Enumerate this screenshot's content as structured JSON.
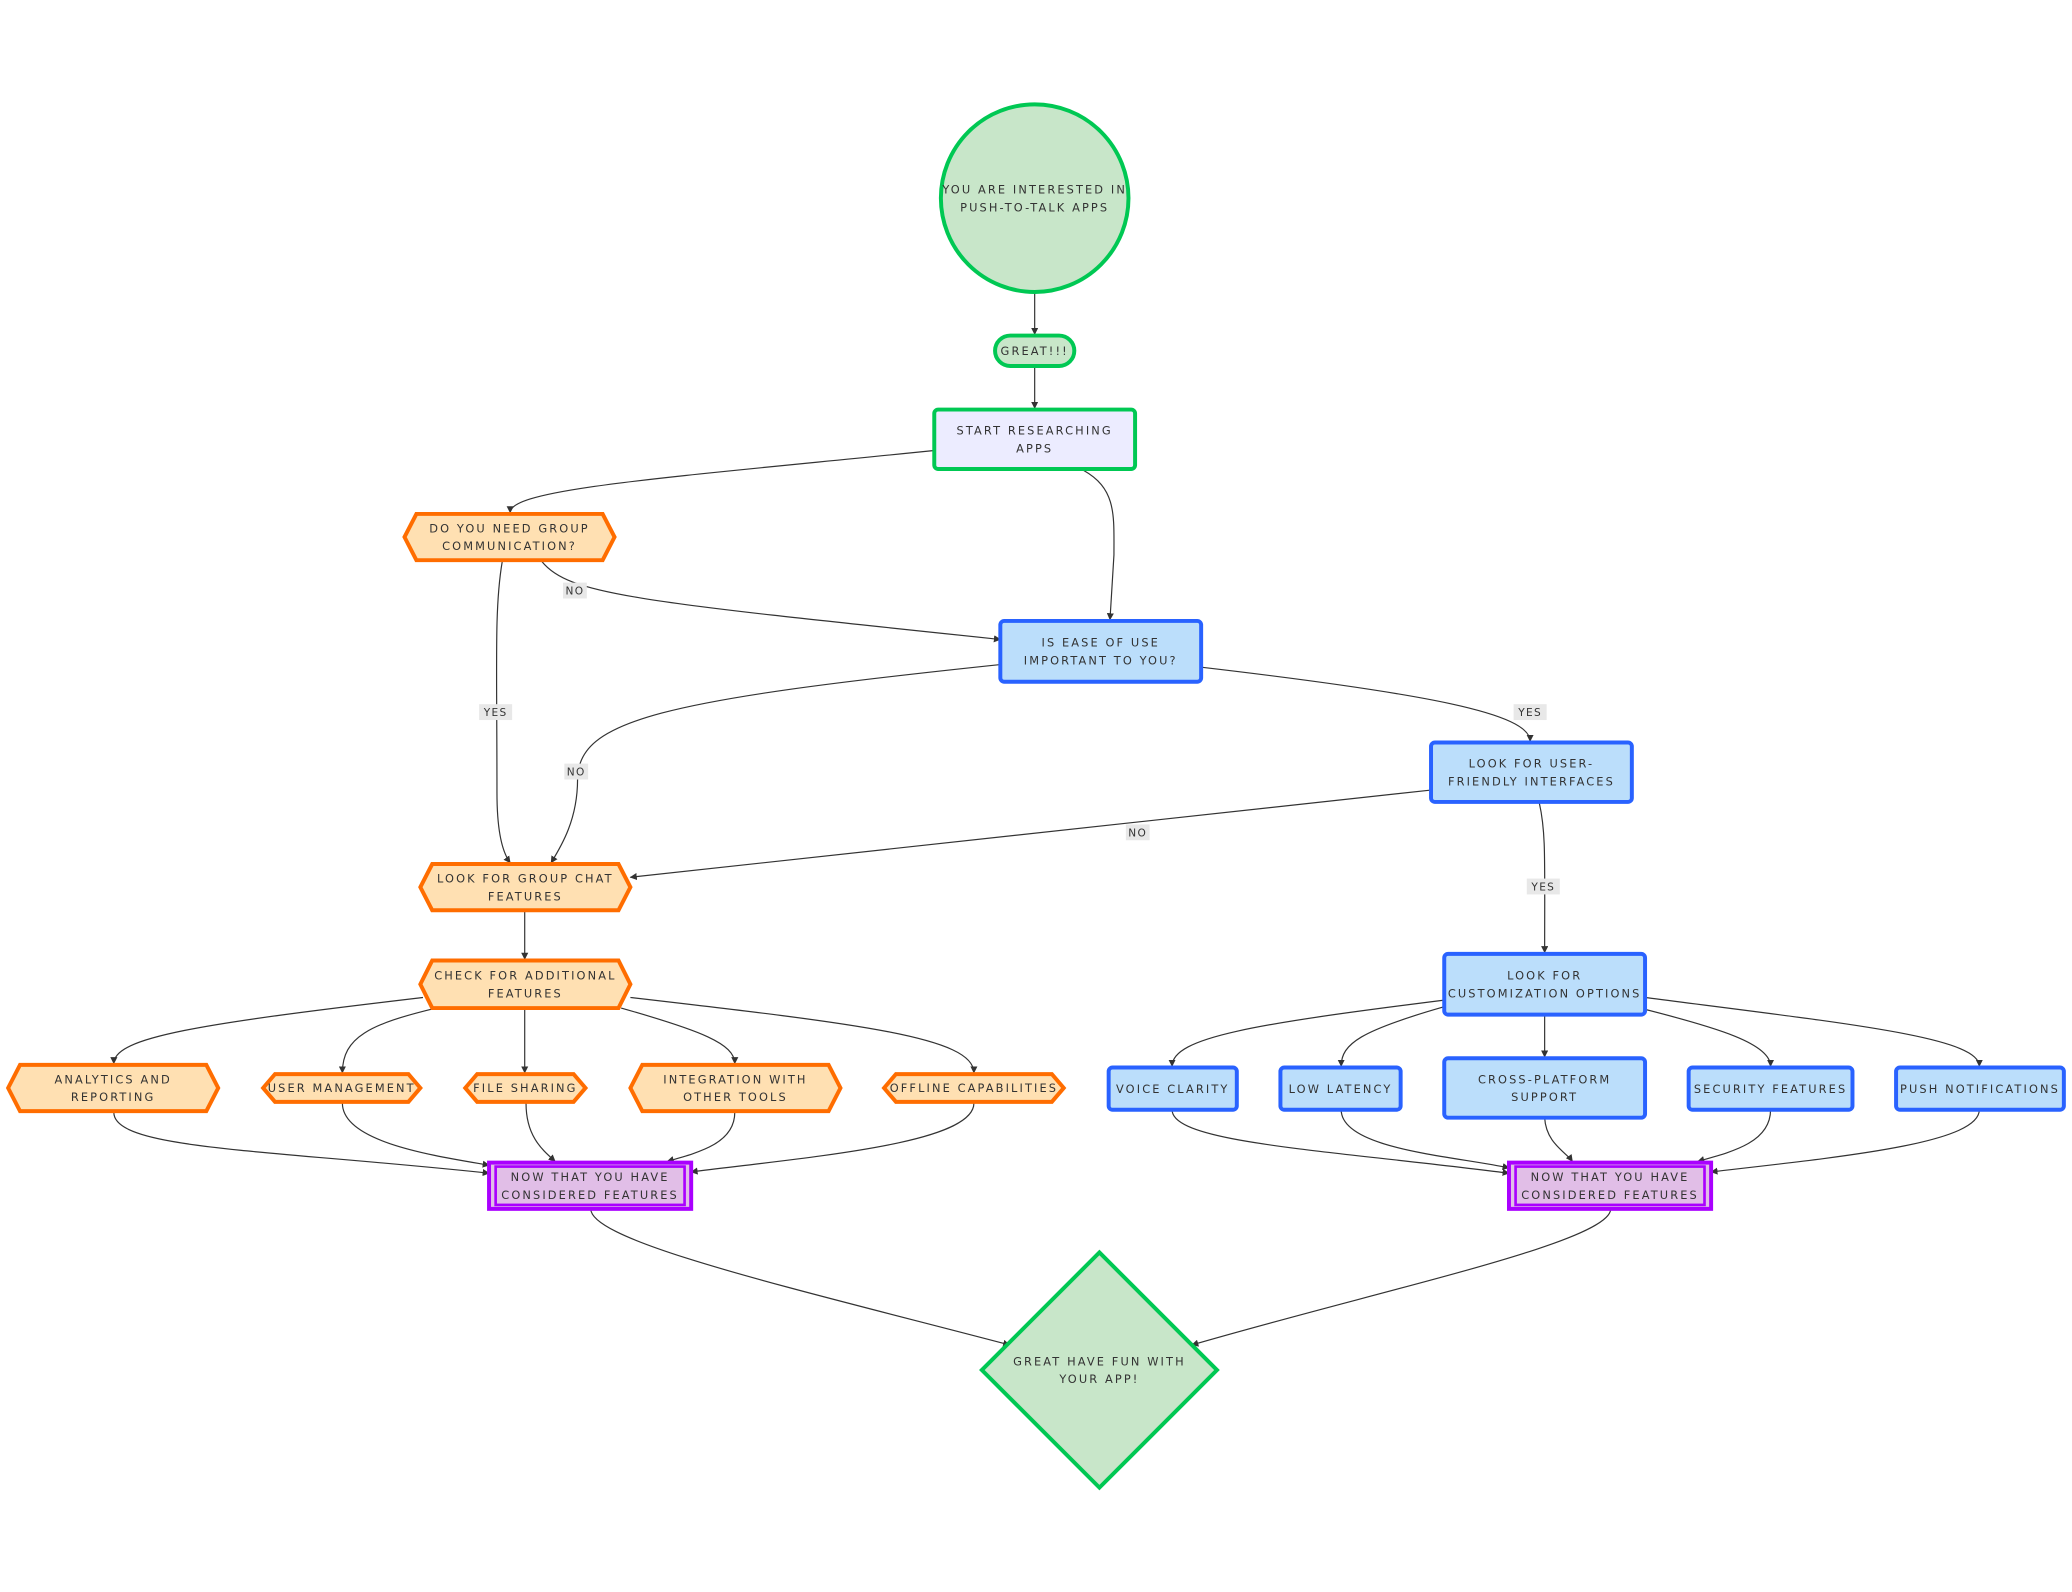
{
  "colors": {
    "green_fill": "#c8e6c9",
    "green_stroke": "#00c853",
    "lavender_fill": "#ececff",
    "orange_fill": "#ffe0b2",
    "orange_stroke": "#ff6d00",
    "blue_fill": "#bbdefb",
    "blue_stroke": "#2962ff",
    "purple_fill": "#e1bee7",
    "purple_stroke": "#aa00ff",
    "edge": "#333333"
  },
  "nodes": [
    {
      "id": "start",
      "shape": "circle",
      "style": "green",
      "lines": [
        "YOU ARE INTERESTED IN",
        "PUSH-TO-TALK APPS"
      ]
    },
    {
      "id": "great",
      "shape": "stadium",
      "style": "green",
      "lines": [
        "GREAT!!!"
      ]
    },
    {
      "id": "research",
      "shape": "rect",
      "style": "lavender",
      "lines": [
        "START RESEARCHING",
        "APPS"
      ]
    },
    {
      "id": "groupcomm",
      "shape": "hexagon",
      "style": "orange",
      "lines": [
        "DO YOU NEED GROUP",
        "COMMUNICATION?"
      ]
    },
    {
      "id": "ease",
      "shape": "rect",
      "style": "blue",
      "lines": [
        "IS EASE OF USE",
        "IMPORTANT TO YOU?"
      ]
    },
    {
      "id": "userfriendly",
      "shape": "rect",
      "style": "blue",
      "lines": [
        "LOOK FOR USER-",
        "FRIENDLY INTERFACES"
      ]
    },
    {
      "id": "groupchat",
      "shape": "hexagon",
      "style": "orange",
      "lines": [
        "LOOK FOR GROUP CHAT",
        "FEATURES"
      ]
    },
    {
      "id": "customization",
      "shape": "rect",
      "style": "blue",
      "lines": [
        "LOOK FOR",
        "CUSTOMIZATION OPTIONS"
      ]
    },
    {
      "id": "additional",
      "shape": "hexagon",
      "style": "orange",
      "lines": [
        "CHECK FOR ADDITIONAL",
        "FEATURES"
      ]
    },
    {
      "id": "analytics",
      "shape": "hexagon",
      "style": "orange",
      "lines": [
        "ANALYTICS AND",
        "REPORTING"
      ]
    },
    {
      "id": "usermgmt",
      "shape": "hexagon",
      "style": "orange",
      "lines": [
        "USER MANAGEMENT"
      ]
    },
    {
      "id": "filesharing",
      "shape": "hexagon",
      "style": "orange",
      "lines": [
        "FILE SHARING"
      ]
    },
    {
      "id": "integration",
      "shape": "hexagon",
      "style": "orange",
      "lines": [
        "INTEGRATION WITH",
        "OTHER TOOLS"
      ]
    },
    {
      "id": "offline",
      "shape": "hexagon",
      "style": "orange",
      "lines": [
        "OFFLINE CAPABILITIES"
      ]
    },
    {
      "id": "voice",
      "shape": "rect",
      "style": "blue",
      "lines": [
        "VOICE CLARITY"
      ]
    },
    {
      "id": "latency",
      "shape": "rect",
      "style": "blue",
      "lines": [
        "LOW LATENCY"
      ]
    },
    {
      "id": "cross",
      "shape": "rect",
      "style": "blue",
      "lines": [
        "CROSS-PLATFORM",
        "SUPPORT"
      ]
    },
    {
      "id": "security",
      "shape": "rect",
      "style": "blue",
      "lines": [
        "SECURITY FEATURES"
      ]
    },
    {
      "id": "push",
      "shape": "rect",
      "style": "blue",
      "lines": [
        "PUSH NOTIFICATIONS"
      ]
    },
    {
      "id": "now1",
      "shape": "subroutine",
      "style": "purple",
      "lines": [
        "NOW THAT YOU HAVE",
        "CONSIDERED FEATURES"
      ]
    },
    {
      "id": "now2",
      "shape": "subroutine",
      "style": "purple",
      "lines": [
        "NOW THAT YOU HAVE",
        "CONSIDERED FEATURES"
      ]
    },
    {
      "id": "final",
      "shape": "diamond",
      "style": "green",
      "lines": [
        "GREAT HAVE FUN WITH",
        "YOUR APP!"
      ]
    }
  ],
  "edges": [
    {
      "from": "start",
      "to": "great",
      "label": ""
    },
    {
      "from": "great",
      "to": "research",
      "label": ""
    },
    {
      "from": "research",
      "to": "groupcomm",
      "label": ""
    },
    {
      "from": "research",
      "to": "ease",
      "label": ""
    },
    {
      "from": "groupcomm",
      "to": "ease",
      "label": "NO"
    },
    {
      "from": "groupcomm",
      "to": "groupchat",
      "label": "YES"
    },
    {
      "from": "ease",
      "to": "groupchat",
      "label": "NO"
    },
    {
      "from": "ease",
      "to": "userfriendly",
      "label": "YES"
    },
    {
      "from": "userfriendly",
      "to": "groupchat",
      "label": "NO"
    },
    {
      "from": "userfriendly",
      "to": "customization",
      "label": "YES"
    },
    {
      "from": "groupchat",
      "to": "additional",
      "label": ""
    },
    {
      "from": "additional",
      "to": "analytics",
      "label": ""
    },
    {
      "from": "additional",
      "to": "usermgmt",
      "label": ""
    },
    {
      "from": "additional",
      "to": "filesharing",
      "label": ""
    },
    {
      "from": "additional",
      "to": "integration",
      "label": ""
    },
    {
      "from": "additional",
      "to": "offline",
      "label": ""
    },
    {
      "from": "customization",
      "to": "voice",
      "label": ""
    },
    {
      "from": "customization",
      "to": "latency",
      "label": ""
    },
    {
      "from": "customization",
      "to": "cross",
      "label": ""
    },
    {
      "from": "customization",
      "to": "security",
      "label": ""
    },
    {
      "from": "customization",
      "to": "push",
      "label": ""
    },
    {
      "from": "analytics",
      "to": "now1",
      "label": ""
    },
    {
      "from": "usermgmt",
      "to": "now1",
      "label": ""
    },
    {
      "from": "filesharing",
      "to": "now1",
      "label": ""
    },
    {
      "from": "integration",
      "to": "now1",
      "label": ""
    },
    {
      "from": "offline",
      "to": "now1",
      "label": ""
    },
    {
      "from": "voice",
      "to": "now2",
      "label": ""
    },
    {
      "from": "latency",
      "to": "now2",
      "label": ""
    },
    {
      "from": "cross",
      "to": "now2",
      "label": ""
    },
    {
      "from": "security",
      "to": "now2",
      "label": ""
    },
    {
      "from": "push",
      "to": "now2",
      "label": ""
    },
    {
      "from": "now1",
      "to": "final",
      "label": ""
    },
    {
      "from": "now2",
      "to": "final",
      "label": ""
    }
  ]
}
